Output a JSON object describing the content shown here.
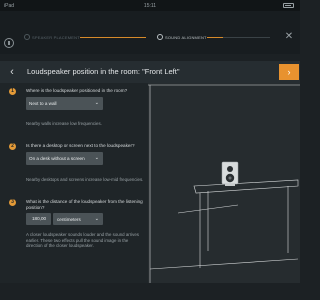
{
  "status_bar": {
    "carrier": "iPad",
    "time": "15:11"
  },
  "steps": [
    {
      "label": "Speaker Placement",
      "progress": 1.0
    },
    {
      "label": "Sound Alignment",
      "progress": 0.25
    }
  ],
  "header": {
    "title": "Loudspeaker position in the room: \"Front Left\""
  },
  "questions": [
    {
      "number": "1",
      "text": "Where is the loudspeaker positioned in the room?",
      "selected": "Next to a wall",
      "hint": "Nearby walls increase low frequencies."
    },
    {
      "number": "2",
      "text": "Is there a desktop or screen next to the loudspeaker?",
      "selected": "On a desk without a screen",
      "hint": "Nearby desktops and screens increase low-mid frequencies."
    },
    {
      "number": "3",
      "text": "What is the distance of the loudspeaker from the listening position?",
      "value": "180,00",
      "unit": "centimeters",
      "hint": "A closer loudspeaker sounds louder and the sound arrives earlier. These two effects pull the sound image in the direction of the closer loudspeaker."
    }
  ],
  "icons": {
    "back": "chevron-left-icon",
    "next": "chevron-right-icon",
    "close": "close-icon",
    "dropdown": "chevron-down-icon"
  },
  "colors": {
    "accent": "#e8922f",
    "background": "#1c2124",
    "panel": "#1f2528",
    "field": "#4b5357"
  }
}
